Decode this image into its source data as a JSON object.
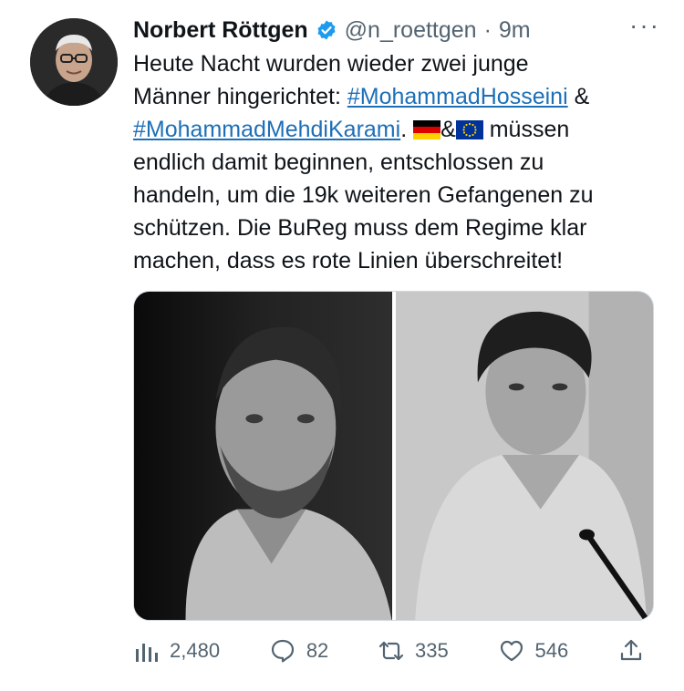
{
  "author": {
    "display_name": "Norbert Röttgen",
    "handle": "@n_roettgen",
    "separator": "·",
    "time": "9m",
    "avatar_icon": "profile-photo",
    "verified_color": "#1d9bf0"
  },
  "more_label": "···",
  "tweet": {
    "l1": "Heute Nacht wurden wieder zwei junge",
    "l2_pre": "Männer hingerichtet: ",
    "hashtag1": "#MohammadHosseini",
    "l2_post": " &",
    "hashtag2": "#MohammadMehdiKarami",
    "l3_a": ". ",
    "l3_amp": "&",
    "l3_b": " müssen",
    "l4": "endlich damit beginnen, entschlossen zu",
    "l5": "handeln, um die 19k weiteren Gefangenen zu",
    "l6": "schützen. Die BuReg muss dem Regime klar",
    "l7": "machen, dass es rote Linien überschreitet!",
    "flag1": "germany-flag",
    "flag2": "eu-flag",
    "link_color": "#1d6fb8"
  },
  "media": {
    "photo_left": "man-portrait-left-bw",
    "photo_right": "man-portrait-right-bw"
  },
  "actions": {
    "views": "2,480",
    "replies": "82",
    "retweets": "335",
    "likes": "546",
    "icon_color": "#536471"
  }
}
